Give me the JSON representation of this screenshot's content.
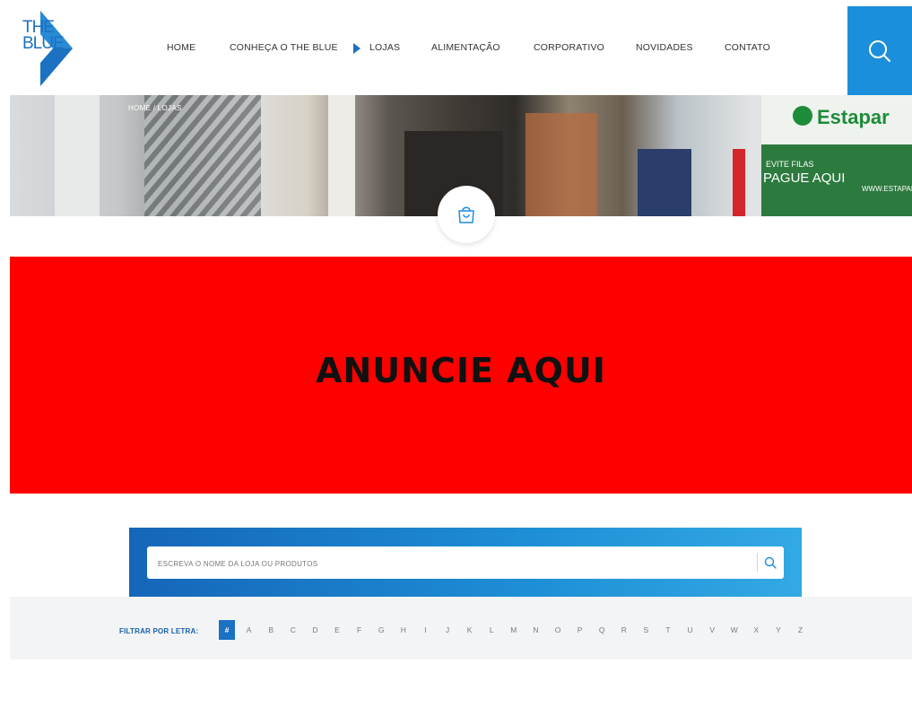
{
  "logo": {
    "line1": "THE",
    "line2": "BLUE"
  },
  "nav": {
    "items": [
      {
        "label": "HOME",
        "active": false
      },
      {
        "label": "CONHEÇA O THE BLUE",
        "active": false
      },
      {
        "label": "LOJAS",
        "active": true
      },
      {
        "label": "ALIMENTAÇÃO",
        "active": false
      },
      {
        "label": "CORPORATIVO",
        "active": false
      },
      {
        "label": "NOVIDADES",
        "active": false
      },
      {
        "label": "CONTATO",
        "active": false
      }
    ]
  },
  "banner": {
    "breadcrumb": [
      "HOME",
      "LOJAS"
    ],
    "estapar": "Estapar",
    "sign_small": "EVITE FILAS",
    "sign_big": "PAGUE AQUI",
    "sign_url": "WWW.ESTAPAR.C"
  },
  "ad": {
    "text": "ANUNCIE AQUI"
  },
  "search": {
    "placeholder": "ESCREVA O NOME DA LOJA OU PRODUTOS"
  },
  "filter": {
    "label": "FILTRAR POR LETRA:",
    "letters": [
      "#",
      "A",
      "B",
      "C",
      "D",
      "E",
      "F",
      "G",
      "H",
      "I",
      "J",
      "K",
      "L",
      "M",
      "N",
      "O",
      "P",
      "Q",
      "R",
      "S",
      "T",
      "U",
      "V",
      "W",
      "X",
      "Y",
      "Z"
    ],
    "active": "#"
  },
  "colors": {
    "brand_blue": "#1b71c2",
    "search_blue": "#1b8fdc",
    "ad_red": "#ff0000"
  }
}
